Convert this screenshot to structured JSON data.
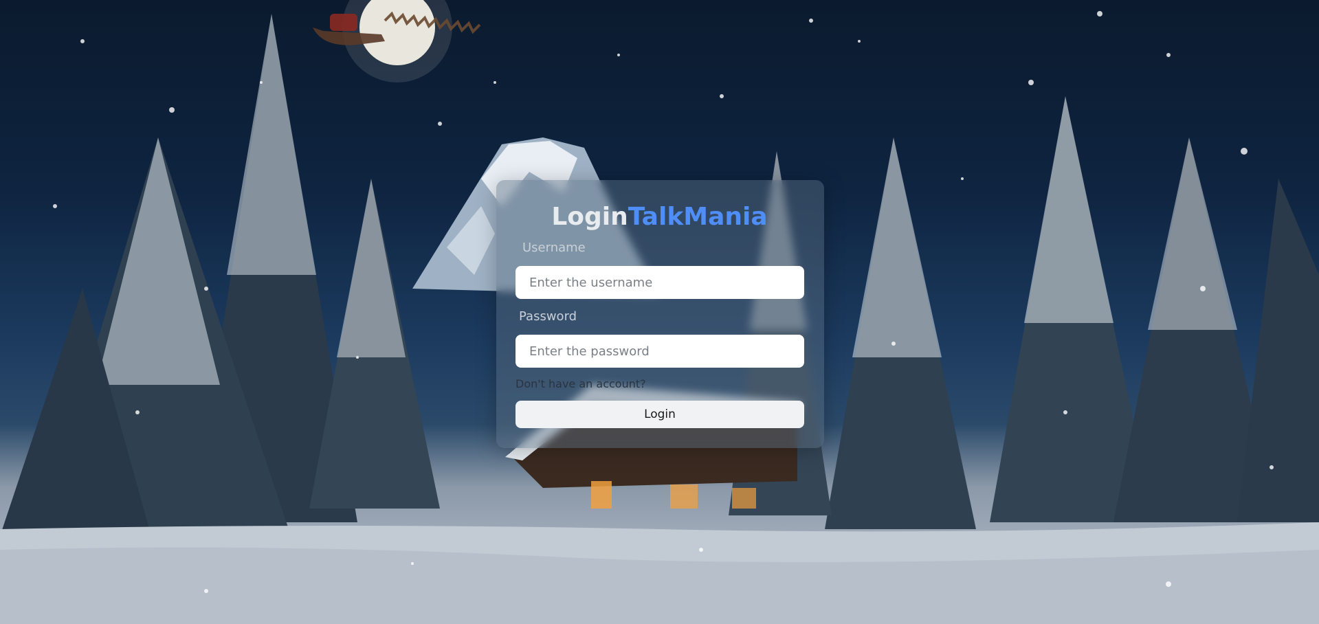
{
  "form": {
    "title_part1": "Login",
    "title_part2": "TalkMania",
    "username_label": "Username",
    "username_placeholder": "Enter the username",
    "password_label": "Password",
    "password_placeholder": "Enter the password",
    "signup_link": "Don't have an account?",
    "login_button": "Login"
  },
  "colors": {
    "accent": "#4f8ef7",
    "card_bg": "rgba(90,110,130,0.45)",
    "sky_top": "#0b1a2e",
    "snow": "#c4ccd6"
  }
}
